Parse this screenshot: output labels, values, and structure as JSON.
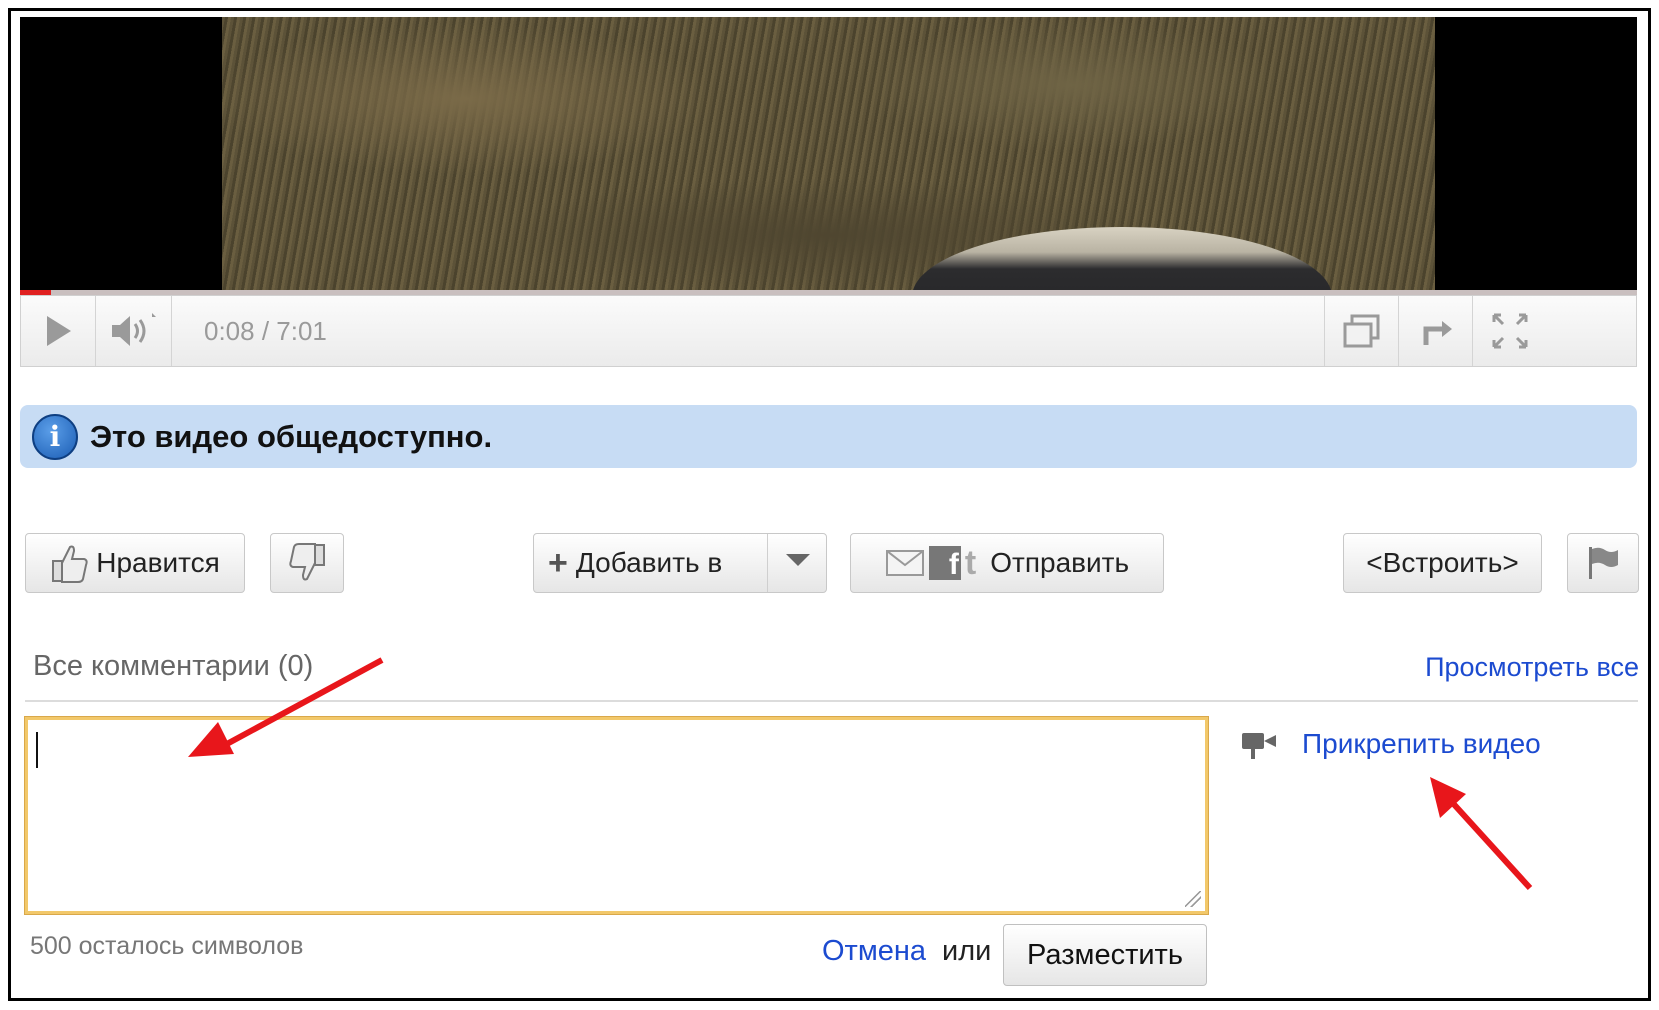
{
  "player": {
    "time": "0:08 / 7:01",
    "progress_fraction": 0.019,
    "icons": [
      "play-icon",
      "volume-icon",
      "popout-icon",
      "share-icon",
      "fullscreen-icon"
    ]
  },
  "notice": {
    "text": "Это видео общедоступно."
  },
  "actions": {
    "like_label": "Нравится",
    "add_label": "Добавить в",
    "share_label": "Отправить",
    "embed_label": "<Встроить>"
  },
  "comments": {
    "title": "Все комментарии (0)",
    "view_all": "Просмотреть все",
    "attach_video": "Прикрепить видео",
    "chars_left": "500 осталось символов",
    "cancel": "Отмена",
    "or": "или",
    "post": "Разместить",
    "input_value": ""
  },
  "colors": {
    "link": "#1c4bd0",
    "progress": "#e02020",
    "notice_bg": "#c7dcf4",
    "annotation_arrow": "#e8161b"
  }
}
